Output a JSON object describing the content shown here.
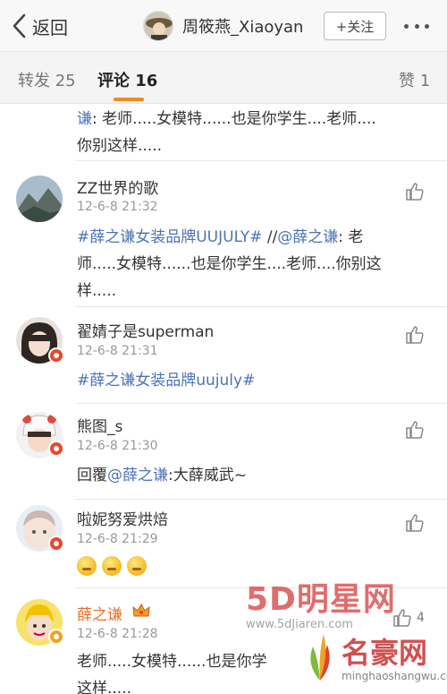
{
  "navbar": {
    "back_label": "返回",
    "title": "周筱燕_Xiaoyan",
    "follow_label": "+关注"
  },
  "tabs": [
    {
      "label": "转发 25",
      "active": false
    },
    {
      "label": "评论 16",
      "active": true
    },
    {
      "label": "赞 1",
      "active": false
    }
  ],
  "partial_comment": {
    "line1_link": "谦",
    "line1_text": ": 老师.....女模特......也是你学生....老师....",
    "line2": "你别这样....."
  },
  "comments": [
    {
      "name": "ZZ世界的歌",
      "time": "12-6-8 21:32",
      "hashtag": "#薛之谦女装品牌UUJULY#",
      "repost_prefix": " //",
      "mention": "@薛之谦",
      "line1_tail": ": 老",
      "line2": "师.....女模特......也是你学生....老师....你别这",
      "line3": "样....."
    },
    {
      "name": "翟婧子是superman",
      "time": "12-6-8 21:31",
      "hashtag": "#薛之谦女装品牌uujuly#"
    },
    {
      "name": "熊图_s",
      "time": "12-6-8 21:30",
      "reply_prefix": "回覆",
      "mention": "@薛之谦",
      "reply_tail": ":大薛威武~"
    },
    {
      "name": "啦妮努爱烘焙",
      "time": "12-6-8 21:29",
      "emoji_icons": [
        "laugh-emoji-icon",
        "laugh-emoji-icon",
        "laugh-emoji-icon"
      ]
    },
    {
      "name": "薛之谦",
      "time": "12-6-8 21:28",
      "likes": "4",
      "line1": "老师.....女模特......也是你学",
      "line2": "这样....."
    }
  ],
  "watermarks": {
    "w1_main": "5D明星网",
    "w1_sub": "www.5dJiaren.com",
    "w2_main": "名豪网",
    "w2_sub": "minghaoshangwu.com"
  },
  "colors": {
    "link": "#4a74b6",
    "accent": "#f08a24",
    "badge_red": "#e8472b",
    "name_orange": "#e8702a"
  }
}
